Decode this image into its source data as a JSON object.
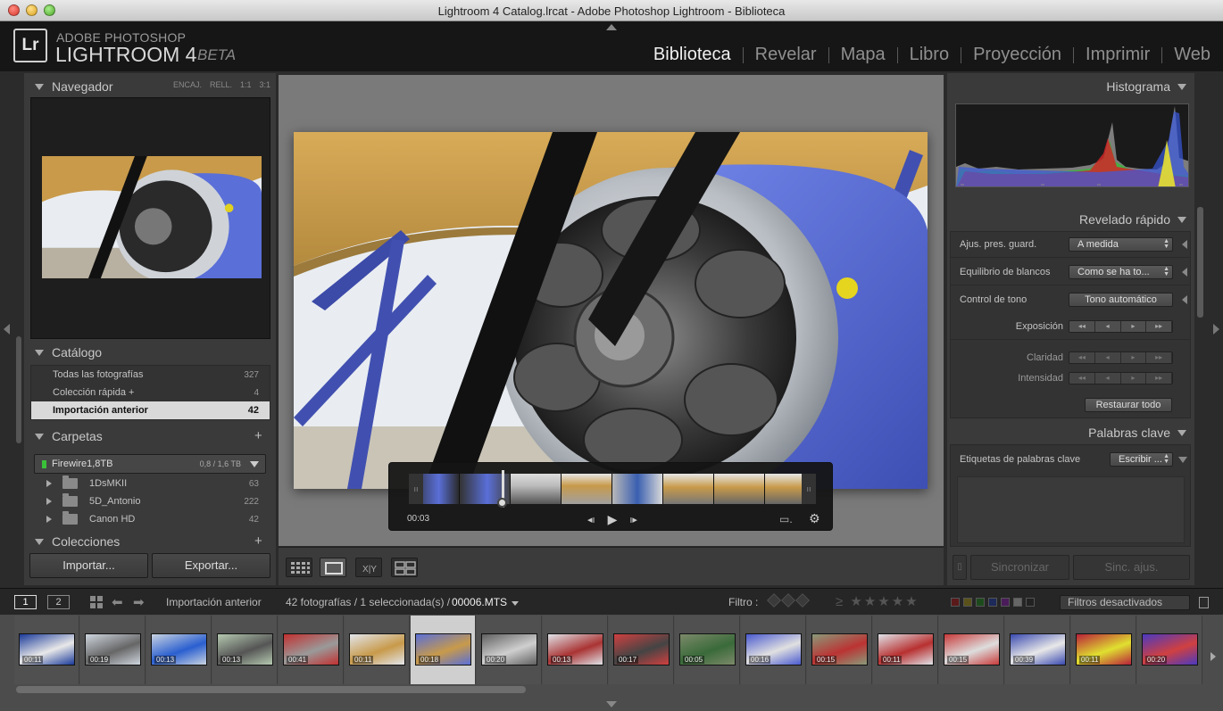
{
  "window": {
    "title": "Lightroom 4 Catalog.lrcat - Adobe Photoshop Lightroom - Biblioteca"
  },
  "logo": {
    "mark": "Lr",
    "line1": "ADOBE PHOTOSHOP",
    "line2": "LIGHTROOM 4",
    "beta": "BETA"
  },
  "modules": [
    "Biblioteca",
    "Revelar",
    "Mapa",
    "Libro",
    "Proyección",
    "Imprimir",
    "Web"
  ],
  "active_module": "Biblioteca",
  "navigator": {
    "title": "Navegador",
    "options": [
      "ENCAJ.",
      "RELL.",
      "1:1",
      "3:1"
    ]
  },
  "catalog": {
    "title": "Catálogo",
    "items": [
      {
        "label": "Todas las fotografías",
        "count": "327"
      },
      {
        "label": "Colección rápida +",
        "count": "4"
      },
      {
        "label": "Importación anterior",
        "count": "42"
      }
    ]
  },
  "folders": {
    "title": "Carpetas",
    "plus": "+",
    "volume": {
      "name": "Firewire1,8TB",
      "space": "0,8 / 1,6 TB"
    },
    "items": [
      {
        "name": "1DsMKII",
        "count": "63"
      },
      {
        "name": "5D_Antonio",
        "count": "222"
      },
      {
        "name": "Canon HD",
        "count": "42"
      }
    ]
  },
  "collections": {
    "title": "Colecciones",
    "plus": "+"
  },
  "left_buttons": {
    "import": "Importar...",
    "export": "Exportar..."
  },
  "video": {
    "time": "00:03",
    "prev_icon": "◂ı",
    "play_icon": "▶",
    "next_icon": "ı▸",
    "frame_icon": "frame-icon",
    "gear_icon": "gear-icon",
    "progress": 0.23
  },
  "histogram": {
    "title": "Histograma"
  },
  "quick_develop": {
    "title": "Revelado rápido",
    "preset_label": "Ajus. pres. guard.",
    "preset_value": "A medida",
    "wb_label": "Equilibrio de blancos",
    "wb_value": "Como se ha to...",
    "tone_label": "Control de tono",
    "tone_button": "Tono automático",
    "exposure_label": "Exposición",
    "clarity_label": "Claridad",
    "vibrance_label": "Intensidad",
    "reset_button": "Restaurar todo",
    "step_glyphs": [
      "◂◂",
      "◂",
      "▸",
      "▸▸"
    ]
  },
  "keywords": {
    "title": "Palabras clave",
    "tags_label": "Etiquetas de palabras clave",
    "tags_value": "Escribir ..."
  },
  "right_buttons": {
    "sync": "Sincronizar",
    "sync_settings": "Sinc. ajus."
  },
  "filmstrip_bar": {
    "screen1": "1",
    "screen2": "2",
    "source": "Importación anterior",
    "count": "42 fotografías / 1 seleccionada(s) /",
    "file": "00006.MTS",
    "filter_label": "Filtro :",
    "stars": "≥ ★★★★★",
    "filters_select": "Filtros desactivados"
  },
  "filmstrip": {
    "durations": [
      "00:11",
      "00:19",
      "00:13",
      "00:13",
      "00:41",
      "00:11",
      "00:18",
      "00:20",
      "00:13",
      "00:17",
      "00:05",
      "00:16",
      "00:15",
      "00:11",
      "00:15",
      "00:39",
      "00:11",
      "00:20"
    ],
    "selected_index": 6
  },
  "colors": {
    "accent_blue": "#5a6fd8",
    "sky": "#e9edf2",
    "wing": "#c89a4a"
  }
}
